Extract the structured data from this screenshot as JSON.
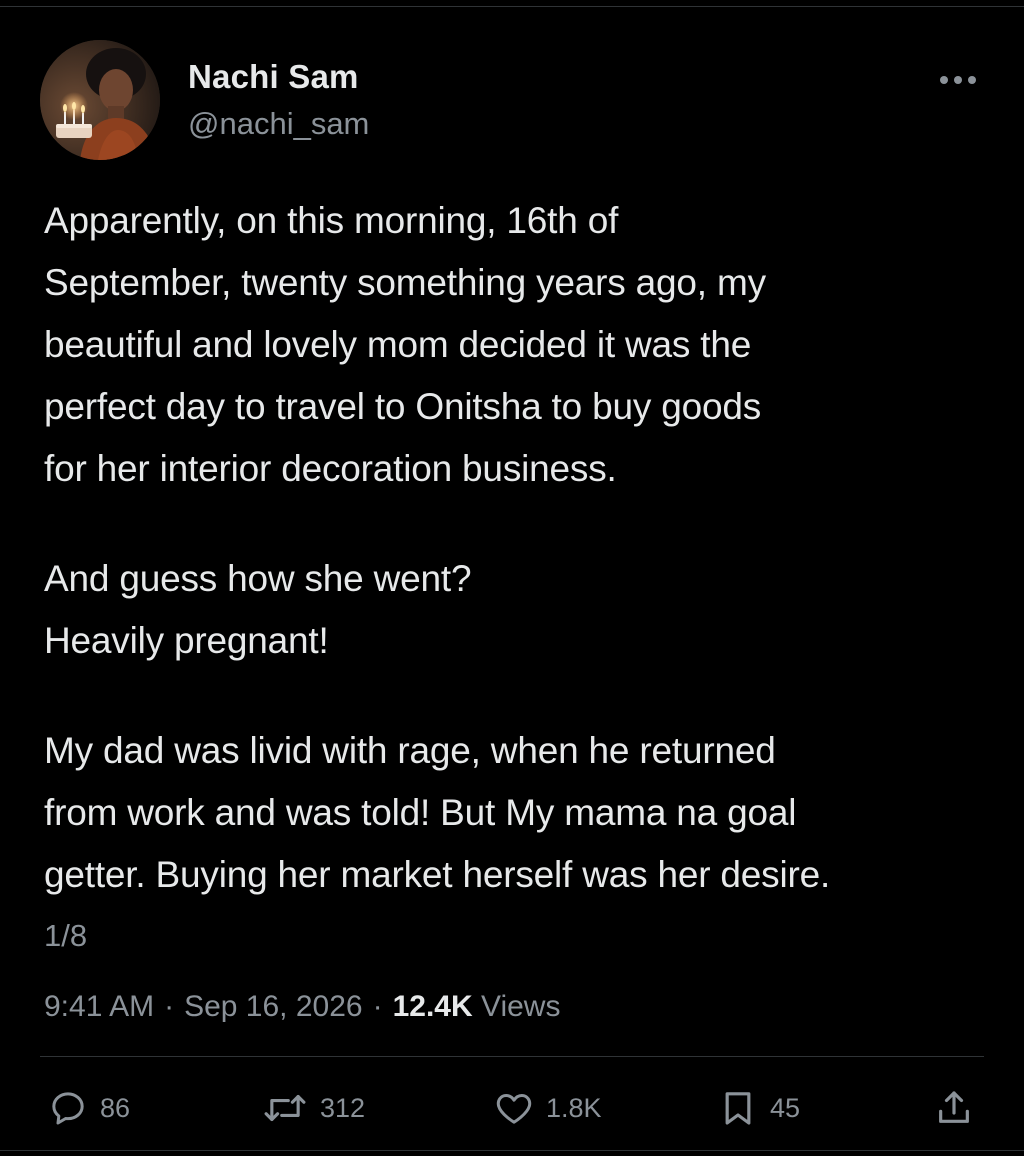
{
  "author": {
    "name": "Nachi Sam",
    "handle": "@nachi_sam"
  },
  "tweet": {
    "paragraphs": [
      "Apparently, on this morning, 16th of\nSeptember, twenty something years ago, my\nbeautiful and lovely mom decided it was the\nperfect day to travel to Onitsha to buy goods\nfor her interior decoration business.",
      "And guess how she went?\nHeavily pregnant!",
      "My dad was livid with rage, when he returned\nfrom work and was told! But My mama na goal\ngetter. Buying her market herself was her desire."
    ],
    "thread_position": "1/8"
  },
  "meta": {
    "time": "9:41 AM",
    "separator": "·",
    "date": "Sep 16, 2026",
    "views_count": "12.4K",
    "views_label": "Views"
  },
  "actions": {
    "replies": "86",
    "reposts": "312",
    "likes": "1.8K",
    "bookmarks": "45"
  },
  "icons": {
    "more": "more-horizontal-icon",
    "reply": "reply-bubble-icon",
    "repost": "repost-arrows-icon",
    "like": "heart-icon",
    "bookmark": "bookmark-icon",
    "share": "share-upload-icon"
  },
  "colors": {
    "background": "#000000",
    "text_primary": "#e7e9ea",
    "text_secondary": "#8b9299",
    "divider": "#2f3336"
  }
}
